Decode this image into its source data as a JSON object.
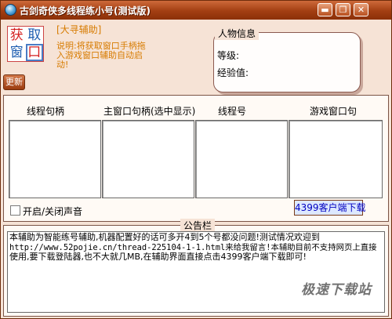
{
  "window": {
    "title": "古剑奇侠多线程练小号(测试版)",
    "controls": {
      "minimize": "▬",
      "restore": "❐",
      "close": "✕"
    }
  },
  "logo": {
    "chars": [
      "获",
      "取",
      "窗",
      "口"
    ]
  },
  "header": {
    "link_tag": "[大寻辅助]",
    "description": "说明:将获取窗口手柄拖入游戏窗口辅助自动启动!"
  },
  "char_info": {
    "title": "人物信息",
    "level_label": "等级:",
    "exp_label": "经验值:"
  },
  "toolbar": {
    "refresh_label": "更新"
  },
  "columns": {
    "thread_handle": "线程句柄",
    "main_window_handle": "主窗口句柄(选中显示)",
    "thread_id": "线程号",
    "game_window": "游戏窗口句"
  },
  "options": {
    "sound_toggle_label": "开启/关闭声音",
    "sound_checked": false
  },
  "client_button_label": "4399客户端下载",
  "notice": {
    "title": "公告栏",
    "line1": "本辅助为智能练号辅助,机器配置好的话可多开4到5个号都没问题!测试情况欢迎到",
    "line2": "http://www.52pojie.cn/thread-225104-1-1.html来给我留言!本辅助目前不支持网页上直接",
    "line3": "使用,要下载登陆器,也不大就几MB,在辅助界面直接点击4399客户端下载即可!"
  },
  "watermark": "极速下载站",
  "colors": {
    "title_bar": "#a23e12",
    "window_bg": "#f6e3d6",
    "accent_text": "#d77b00",
    "link_blue": "#0000c0"
  }
}
